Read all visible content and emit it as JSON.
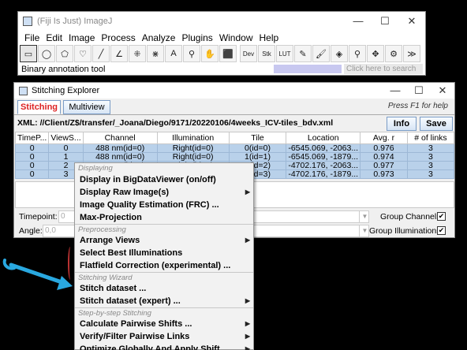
{
  "imagej": {
    "title": "(Fiji Is Just) ImageJ",
    "menus": [
      "File",
      "Edit",
      "Image",
      "Process",
      "Analyze",
      "Plugins",
      "Window",
      "Help"
    ],
    "tools": [
      {
        "name": "rectangle-tool-icon",
        "glyph": "▭"
      },
      {
        "name": "oval-tool-icon",
        "glyph": "◯"
      },
      {
        "name": "polygon-tool-icon",
        "glyph": "⬠"
      },
      {
        "name": "freehand-tool-icon",
        "glyph": "♡"
      },
      {
        "name": "line-tool-icon",
        "glyph": "╱"
      },
      {
        "name": "angle-tool-icon",
        "glyph": "∠"
      },
      {
        "name": "multipoint-tool-icon",
        "glyph": "⁜"
      },
      {
        "name": "wand-tool-icon",
        "glyph": "⋇"
      },
      {
        "name": "text-tool-icon",
        "glyph": "A"
      },
      {
        "name": "magnifier-tool-icon",
        "glyph": "⚲"
      },
      {
        "name": "hand-tool-icon",
        "glyph": "✋"
      },
      {
        "name": "dropper-tool-icon",
        "glyph": "⬛"
      },
      {
        "name": "dev-tool-icon",
        "glyph": "Dev"
      },
      {
        "name": "stk-tool-icon",
        "glyph": "Stk"
      },
      {
        "name": "lut-tool-icon",
        "glyph": "LUT"
      },
      {
        "name": "pencil-tool-icon",
        "glyph": "✎"
      },
      {
        "name": "brush-tool-icon",
        "glyph": "🖌"
      },
      {
        "name": "flood-fill-tool-icon",
        "glyph": "◈"
      },
      {
        "name": "search-tool-icon",
        "glyph": "⚲"
      },
      {
        "name": "move-tool-icon",
        "glyph": "✥"
      },
      {
        "name": "stitch-tool-icon",
        "glyph": "⚙"
      },
      {
        "name": "more-tools-icon",
        "glyph": "≫"
      }
    ],
    "status": "Binary annotation tool",
    "search_placeholder": "Click here to search"
  },
  "stitching": {
    "title": "Stitching Explorer",
    "tabs": [
      "Stitching",
      "Multiview"
    ],
    "help": "Press F1 for help",
    "xml_path": "XML: //Client/Z$/transfer/_Joana/Diego/9171/20220106/4weeks_ICV-tiles_bdv.xml",
    "info_label": "Info",
    "save_label": "Save",
    "columns": [
      "TimeP...",
      "ViewS...",
      "Channel",
      "Illumination",
      "Tile",
      "Location",
      "Avg. r",
      "# of links"
    ],
    "rows": [
      [
        "0",
        "0",
        "488 nm(id=0)",
        "Right(id=0)",
        "0(id=0)",
        "-6545.069, -2063...",
        "0.976",
        "3"
      ],
      [
        "0",
        "1",
        "488 nm(id=0)",
        "Right(id=0)",
        "1(id=1)",
        "-6545.069, -1879...",
        "0.974",
        "3"
      ],
      [
        "0",
        "2",
        "488 nm(id=0)",
        "Right(id=0)",
        "2(id=2)",
        "-4702.176, -2063...",
        "0.977",
        "3"
      ],
      [
        "0",
        "3",
        "488 nm(id=0)",
        "Right(id=0)",
        "3(id=3)",
        "-4702.176, -1879...",
        "0.973",
        "3"
      ]
    ],
    "timepoint_label": "Timepoint:",
    "timepoint_value": "0",
    "angle_label": "Angle:",
    "angle_value": "0,0",
    "group_channels_label": "Group Channels:",
    "group_illuminations_label": "Group Illuminations:",
    "group_channels_checked": "✔",
    "group_illuminations_checked": "✔"
  },
  "menu": {
    "sections": [
      {
        "header": "Displaying",
        "items": [
          {
            "label": "Display in BigDataViewer (on/off)",
            "submenu": false
          },
          {
            "label": "Display Raw Image(s)",
            "submenu": true
          },
          {
            "label": "Image Quality Estimation (FRC) ...",
            "submenu": false
          },
          {
            "label": "Max-Projection",
            "submenu": false
          }
        ]
      },
      {
        "header": "Preprocessing",
        "items": [
          {
            "label": "Arrange Views",
            "submenu": true
          },
          {
            "label": "Select Best Illuminations",
            "submenu": false
          },
          {
            "label": "Flatfield Correction (experimental) ...",
            "submenu": false
          }
        ]
      },
      {
        "header": "Stitching Wizard",
        "items": [
          {
            "label": "Stitch dataset ...",
            "submenu": false
          },
          {
            "label": "Stitch dataset (expert) ...",
            "submenu": true
          }
        ]
      },
      {
        "header": "Step-by-step Stitching",
        "items": [
          {
            "label": "Calculate Pairwise Shifts ...",
            "submenu": true
          },
          {
            "label": "Verify/Filter Pairwise Links",
            "submenu": true
          },
          {
            "label": "Optimize Globally And Apply Shift",
            "submenu": true
          }
        ]
      }
    ],
    "arrow_glyph": "▶"
  },
  "colors": {
    "selected_row": "#b9d1ea",
    "menu_highlight": "#cfe1f5",
    "annotation_arrow": "#29a8e0",
    "active_tab_text": "#dd2222"
  }
}
